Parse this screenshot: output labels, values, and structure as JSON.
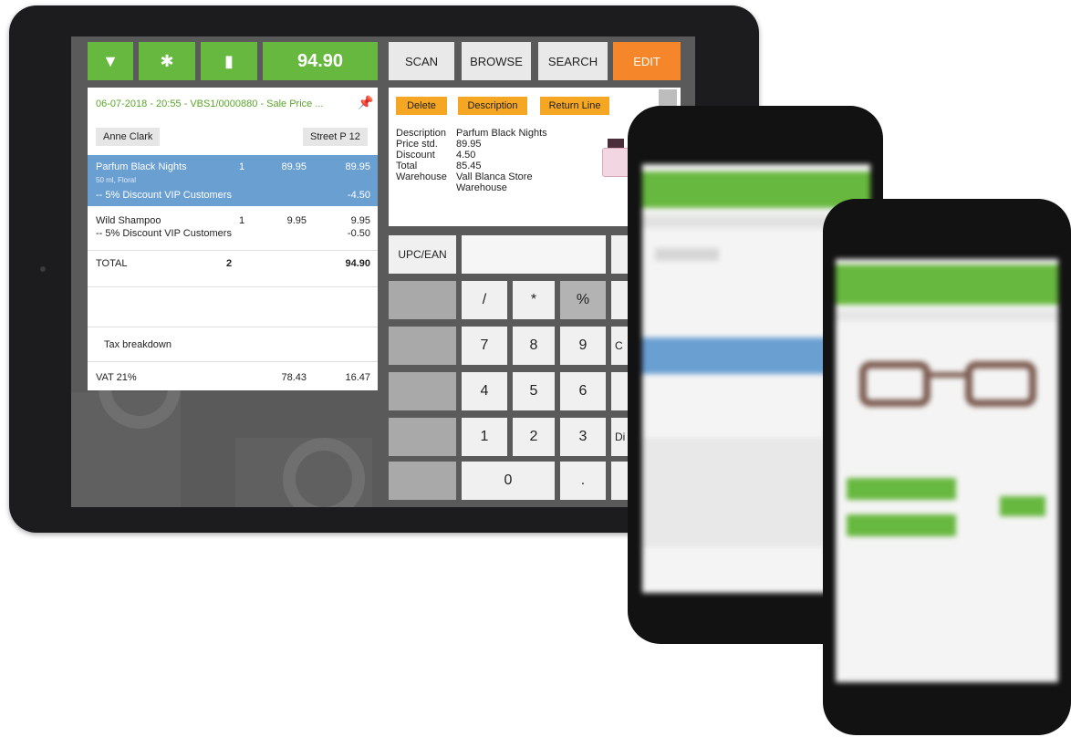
{
  "toolbar": {
    "dropdown_icon": "chevron-down-icon",
    "star_icon": "asterisk-icon",
    "delete_icon": "trash-icon",
    "total": "94.90"
  },
  "nav": {
    "scan": "SCAN",
    "browse": "BROWSE",
    "search": "SEARCH",
    "edit": "EDIT",
    "accent": "#f5872a",
    "brand": "#67b83f"
  },
  "ticket": {
    "header": "06-07-2018 - 20:55 - VBS1/0000880 - Sale Price ...",
    "customer": "Anne Clark",
    "address": "Street P 12",
    "lines": [
      {
        "name": "Parfum Black Nights",
        "qty": "1",
        "price": "89.95",
        "total": "89.95",
        "sub": "50 ml, Floral",
        "discount": "-- 5% Discount VIP Customers",
        "discount_value": "-4.50"
      },
      {
        "name": "Wild Shampoo",
        "qty": "1",
        "price": "9.95",
        "total": "9.95",
        "discount": "-- 5% Discount VIP Customers",
        "discount_value": "-0.50"
      }
    ],
    "total_label": "TOTAL",
    "total_qty": "2",
    "total_value": "94.90",
    "tax_title": "Tax breakdown",
    "tax": {
      "label": "VAT 21%",
      "base": "78.43",
      "amount": "16.47"
    }
  },
  "detail": {
    "buttons": {
      "delete": "Delete",
      "description": "Description",
      "return_line": "Return Line"
    },
    "labels": [
      "Description",
      "Price std.",
      "Discount",
      "Total",
      "Warehouse"
    ],
    "values": [
      "Parfum Black Nights",
      "89.95",
      "4.50",
      "85.45",
      "Vall Blanca Store Warehouse"
    ]
  },
  "keypad": {
    "upc_label": "UPC/EAN",
    "keys": [
      "/",
      "*",
      "%",
      "7",
      "8",
      "9",
      "4",
      "5",
      "6",
      "1",
      "2",
      "3",
      "0",
      "."
    ],
    "partial_c": "C",
    "partial_di": "Di"
  }
}
